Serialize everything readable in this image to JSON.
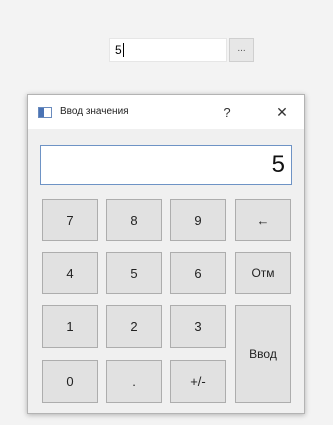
{
  "top_field": {
    "value": "5",
    "ellipsis_label": "..."
  },
  "dialog": {
    "title": "Ввод значения",
    "help_label": "?",
    "close_label": "✕",
    "display_value": "5",
    "keys": {
      "k7": "7",
      "k8": "8",
      "k9": "9",
      "backspace": "←",
      "k4": "4",
      "k5": "5",
      "k6": "6",
      "cancel": "Отм",
      "k1": "1",
      "k2": "2",
      "k3": "3",
      "enter": "Ввод",
      "k0": "0",
      "dot": ".",
      "plusminus": "+/-"
    }
  }
}
